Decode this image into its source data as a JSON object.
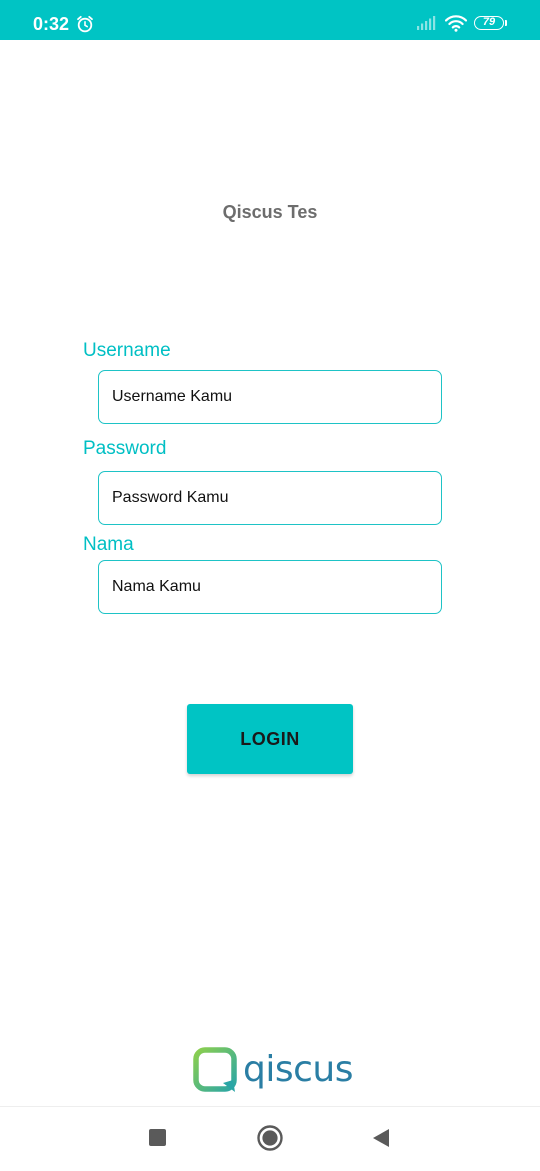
{
  "status_bar": {
    "time": "0:32",
    "battery": "79",
    "background": "#00c4c4",
    "icons": [
      "alarm-icon",
      "signal-icon",
      "wifi-icon",
      "battery-icon"
    ]
  },
  "app": {
    "title": "Qiscus Tes"
  },
  "form": {
    "username": {
      "label": "Username",
      "placeholder": "Username Kamu"
    },
    "password": {
      "label": "Password",
      "placeholder": "Password Kamu"
    },
    "nama": {
      "label": "Nama",
      "placeholder": "Nama Kamu"
    },
    "login_label": "LOGIN"
  },
  "footer": {
    "logo_text": "qiscus"
  },
  "nav_bar": {
    "icons": [
      "recents-icon",
      "home-icon",
      "back-icon"
    ]
  },
  "colors": {
    "accent": "#00c4c4",
    "label": "#00bfc4",
    "title": "#6d6d6d",
    "logo_text": "#2a7ea4"
  }
}
